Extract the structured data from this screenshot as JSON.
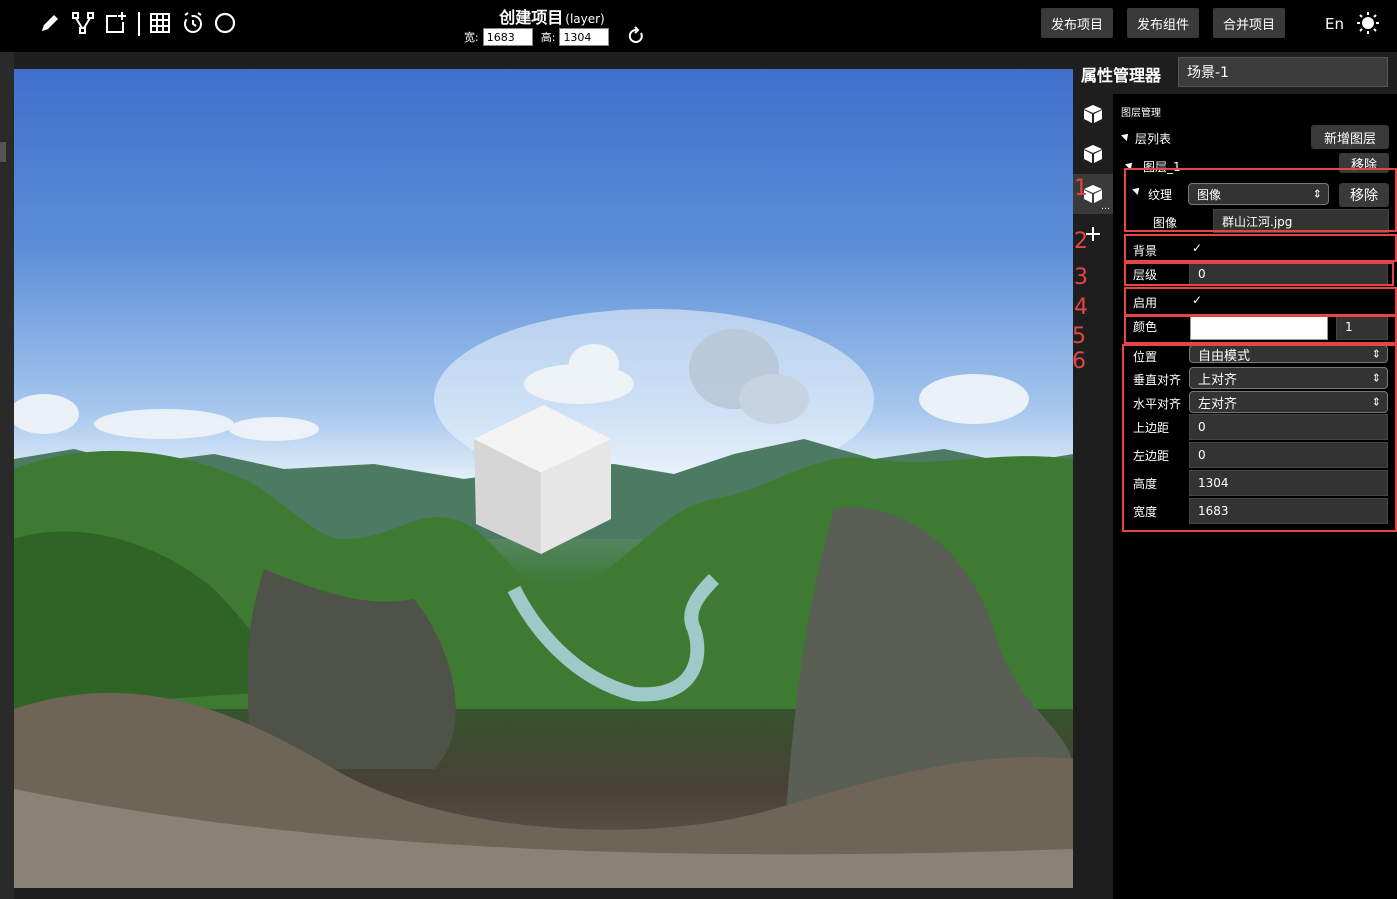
{
  "colors": {
    "accent_red": "#e54545",
    "topbar_bg": "#000000",
    "panel_bg": "#000000",
    "button_bg": "#3a3a3a"
  },
  "toolbar": {
    "tools": [
      {
        "name": "pencil-icon"
      },
      {
        "name": "node-edit-icon"
      },
      {
        "name": "add-frame-icon"
      },
      {
        "name": "grid-icon"
      },
      {
        "name": "timer-icon"
      },
      {
        "name": "circle-icon"
      }
    ],
    "title": "创建项目",
    "title_sub": "(layer)",
    "width_label": "宽:",
    "width_value": "1683",
    "height_label": "高:",
    "height_value": "1304",
    "publish_project": "发布项目",
    "publish_component": "发布组件",
    "merge_project": "合并项目",
    "language": "En"
  },
  "panel": {
    "title": "属性管理器",
    "scene_name": "场景-1",
    "section_title": "图层管理",
    "layer_list_label": "层列表",
    "add_layer": "新增图层",
    "layer_name": "图层_1",
    "remove": "移除",
    "texture_label": "纹理",
    "texture_value": "图像",
    "texture_remove": "移除",
    "image_label": "图像",
    "image_value": "群山江河.jpg",
    "background_label": "背景",
    "background_checked": "✓",
    "level_label": "层级",
    "level_value": "0",
    "enabled_label": "启用",
    "enabled_checked": "✓",
    "color_label": "颜色",
    "color_opacity": "1",
    "position_label": "位置",
    "position_value": "自由模式",
    "valign_label": "垂直对齐",
    "valign_value": "上对齐",
    "halign_label": "水平对齐",
    "halign_value": "左对齐",
    "top_margin_label": "上边距",
    "top_margin_value": "0",
    "left_margin_label": "左边距",
    "left_margin_value": "0",
    "height_label": "高度",
    "height_value": "1304",
    "width_label": "宽度",
    "width_value": "1683"
  },
  "annotations": [
    "1",
    "2",
    "3",
    "4",
    "5",
    "6"
  ]
}
